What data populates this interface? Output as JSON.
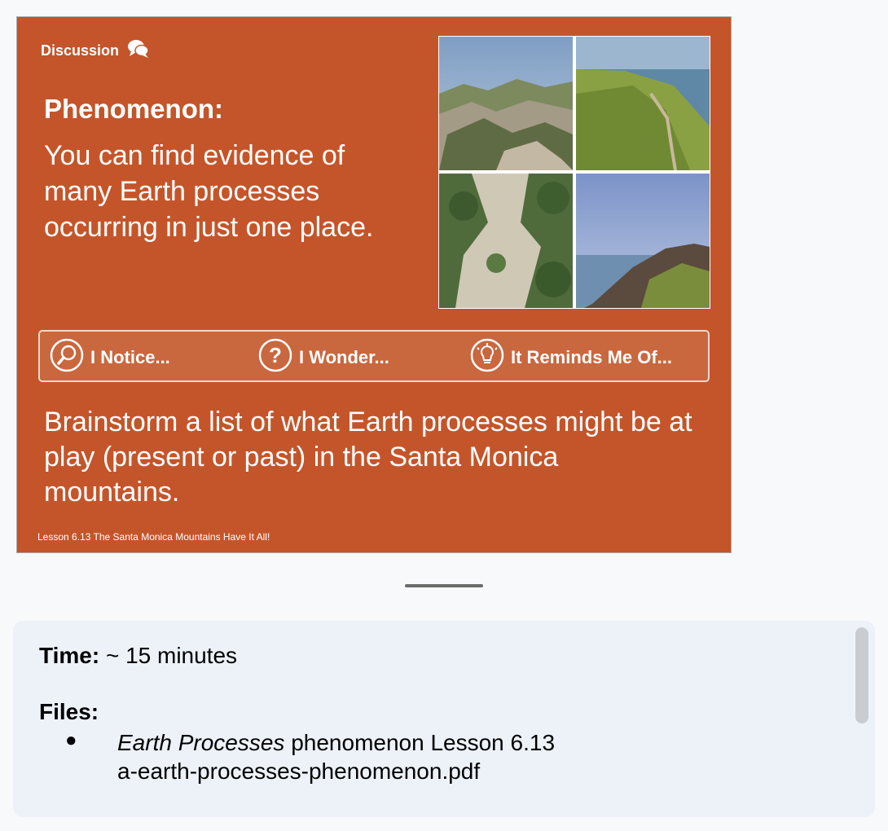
{
  "slide": {
    "discussion_label": "Discussion",
    "phenomenon_label": "Phenomenon:",
    "phenomenon_text": "You can find evidence of many Earth processes occurring in just one place.",
    "bar": {
      "notice": "I Notice...",
      "wonder": "I Wonder...",
      "reminds": "It Reminds Me Of..."
    },
    "brainstorm": "Brainstorm a list of what Earth processes might be at play (present or past) in the Santa Monica mountains.",
    "footer": "Lesson 6.13 The Santa Monica Mountains Have It All!",
    "photo_names": [
      "rocky-mountain-ridge",
      "coastal-trail-ridge",
      "aerial-trail-clearing",
      "coastal-mountains-sea"
    ]
  },
  "notes": {
    "time_label": "Time:",
    "time_value": "~ 15 minutes",
    "files_label": "Files:",
    "file_italic": "Earth Processes",
    "file_rest": "phenomenon Lesson 6.13",
    "file_name": "a-earth-processes-phenomenon.pdf"
  },
  "colors": {
    "slide_bg": "#c4552a",
    "notes_bg": "#edf2f8"
  }
}
